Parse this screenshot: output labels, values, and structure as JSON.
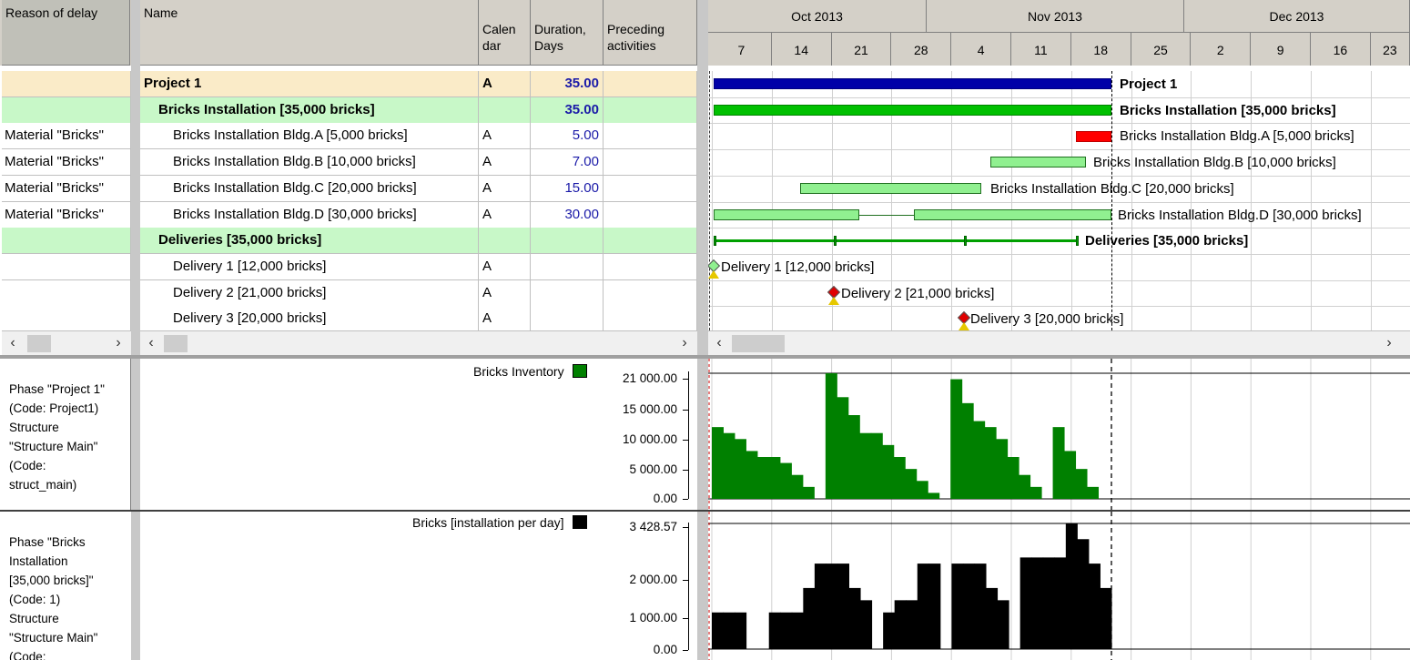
{
  "left_header": {
    "reason_of_delay": "Reason of delay"
  },
  "table_header": {
    "name": "Name",
    "calendar": "Calen\ndar",
    "duration": "Duration,\nDays",
    "preceding": "Preceding\nactivities"
  },
  "timeline": {
    "months": [
      {
        "label": "Oct 2013"
      },
      {
        "label": "Nov 2013"
      },
      {
        "label": "Dec 2013"
      }
    ],
    "days": [
      "7",
      "14",
      "21",
      "28",
      "4",
      "11",
      "18",
      "25",
      "2",
      "9",
      "16",
      "23"
    ]
  },
  "rows": [
    {
      "reason": "",
      "name": "Project 1",
      "calendar": "A",
      "duration": "35.00",
      "level": 0,
      "style": "project",
      "bar_label": "Project 1"
    },
    {
      "reason": "",
      "name": "Bricks Installation [35,000 bricks]",
      "calendar": "",
      "duration": "35.00",
      "level": 1,
      "style": "summary",
      "bar_label": "Bricks Installation [35,000 bricks]"
    },
    {
      "reason": "Material \"Bricks\"",
      "name": "Bricks Installation  Bldg.A [5,000 bricks]",
      "calendar": "A",
      "duration": "5.00",
      "level": 2,
      "style": "task",
      "bar_label": "Bricks Installation  Bldg.A [5,000 bricks]"
    },
    {
      "reason": "Material \"Bricks\"",
      "name": "Bricks Installation Bldg.B [10,000 bricks]",
      "calendar": "A",
      "duration": "7.00",
      "level": 2,
      "style": "task",
      "bar_label": "Bricks Installation Bldg.B [10,000 bricks]"
    },
    {
      "reason": "Material \"Bricks\"",
      "name": "Bricks Installation Bldg.C [20,000 bricks]",
      "calendar": "A",
      "duration": "15.00",
      "level": 2,
      "style": "task",
      "bar_label": "Bricks Installation Bldg.C [20,000 bricks]"
    },
    {
      "reason": "Material \"Bricks\"",
      "name": "Bricks Installation Bldg.D [30,000 bricks]",
      "calendar": "A",
      "duration": "30.00",
      "level": 2,
      "style": "task",
      "bar_label": "Bricks Installation Bldg.D [30,000 bricks]"
    },
    {
      "reason": "",
      "name": "Deliveries [35,000 bricks]",
      "calendar": "",
      "duration": "",
      "level": 1,
      "style": "summary",
      "bar_label": "Deliveries [35,000 bricks]"
    },
    {
      "reason": "",
      "name": "Delivery 1 [12,000 bricks]",
      "calendar": "A",
      "duration": "",
      "level": 2,
      "style": "milestone",
      "bar_label": "Delivery 1 [12,000 bricks]"
    },
    {
      "reason": "",
      "name": "Delivery 2 [21,000 bricks]",
      "calendar": "A",
      "duration": "",
      "level": 2,
      "style": "milestone",
      "bar_label": "Delivery 2 [21,000 bricks]"
    },
    {
      "reason": "",
      "name": "Delivery 3 [20,000 bricks]",
      "calendar": "A",
      "duration": "",
      "level": 2,
      "style": "milestone",
      "bar_label": "Delivery 3 [20,000 bricks]"
    }
  ],
  "colors": {
    "project_bar": "#0000a8",
    "summary_bar": "#00c000",
    "task_bar": "#90f090",
    "critical_bar": "#ff0000",
    "project_row_bg": "#faebc8",
    "summary_row_bg": "#c8f8c8",
    "inventory_fill": "#008000",
    "installation_fill": "#000000"
  },
  "phase_panels": [
    {
      "text": "Phase \"Project 1\"\n(Code: Project1)\nStructure\n\"Structure Main\"\n(Code:\nstruct_main)"
    },
    {
      "text": "Phase \"Bricks\nInstallation\n[35,000 bricks]\"\n(Code: 1)\nStructure\n\"Structure Main\"\n(Code:"
    }
  ],
  "chart_data": [
    {
      "type": "area",
      "title": "",
      "legend": "Bricks Inventory",
      "yticks": [
        "21 000.00",
        "15 000.00",
        "10 000.00",
        "5 000.00",
        "0.00"
      ],
      "ylim": [
        0,
        21000
      ],
      "x_unit": "day offset from Oct 7 2013",
      "series": [
        {
          "name": "Bricks Inventory",
          "x": [
            0,
            1,
            2,
            3,
            4,
            5,
            6,
            7,
            8,
            9,
            10,
            11,
            12,
            13,
            14,
            15,
            16,
            17,
            18,
            19,
            20,
            21,
            22,
            23,
            24,
            25,
            26,
            27,
            28,
            29,
            30,
            31,
            32,
            33,
            34
          ],
          "values": [
            12000,
            11000,
            10000,
            8000,
            7000,
            7000,
            6000,
            4000,
            2000,
            0,
            21000,
            17000,
            14000,
            11000,
            11000,
            9000,
            7000,
            5000,
            3000,
            1000,
            0,
            20000,
            16000,
            13000,
            12000,
            10000,
            7000,
            4000,
            2000,
            0,
            12000,
            8000,
            5000,
            2000,
            0
          ]
        }
      ]
    },
    {
      "type": "bar",
      "title": "",
      "legend": "Bricks [installation per day]",
      "yticks": [
        "3 428.57",
        "2 000.00",
        "1 000.00",
        "0.00"
      ],
      "ylim": [
        0,
        3428.57
      ],
      "series": [
        {
          "name": "Bricks [installation per day]",
          "x": [
            0,
            1,
            2,
            3,
            4,
            5,
            6,
            7,
            8,
            9,
            10,
            11,
            12,
            13,
            14,
            15,
            16,
            17,
            18,
            19,
            20,
            21,
            22,
            23,
            24,
            25,
            26,
            27,
            28,
            29,
            30,
            31,
            32,
            33,
            34
          ],
          "values": [
            1000,
            1000,
            1000,
            0,
            0,
            1000,
            1000,
            1000,
            1667,
            2333,
            2333,
            2333,
            1667,
            1333,
            0,
            1000,
            1333,
            1333,
            2333,
            2333,
            0,
            2333,
            2333,
            2333,
            1667,
            1333,
            0,
            2500,
            2500,
            2500,
            2500,
            3428,
            3000,
            2333,
            1667
          ]
        }
      ]
    }
  ]
}
